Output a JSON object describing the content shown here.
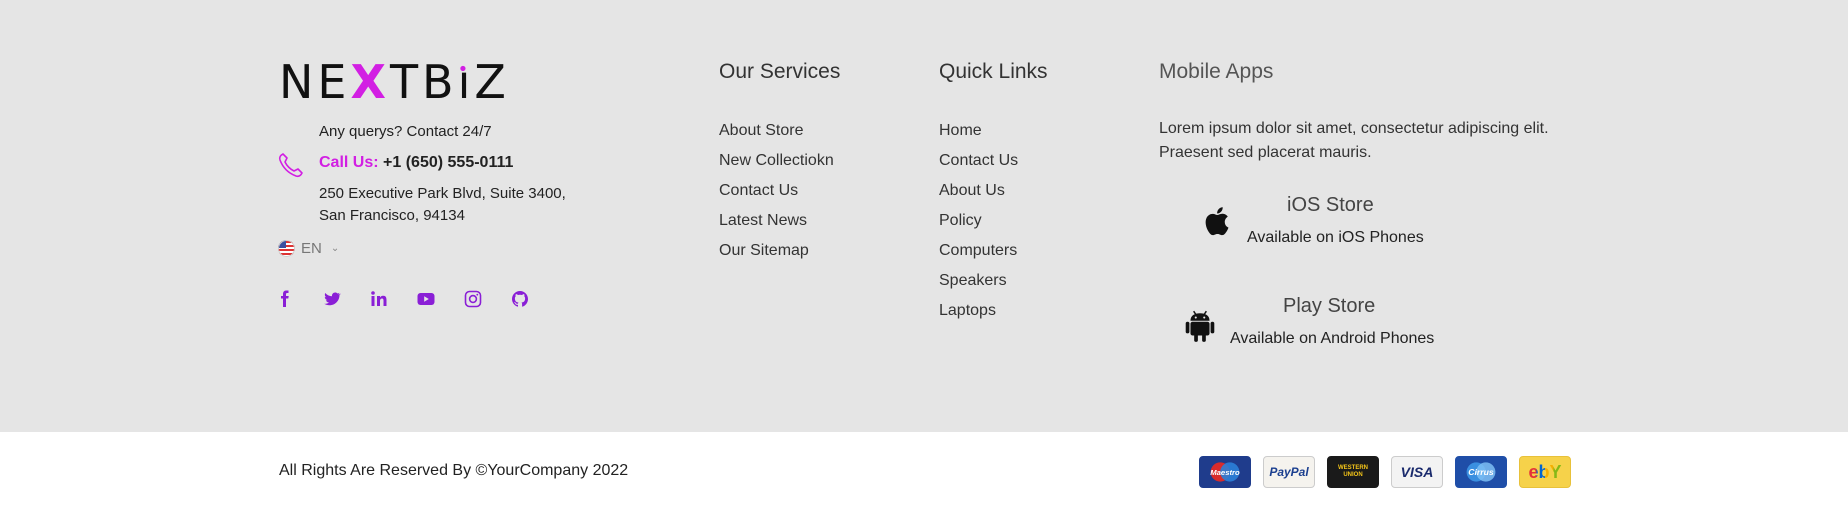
{
  "brand": {
    "logo": {
      "part1": "NE",
      "accent": "X",
      "part2": "TB",
      "i_stem": "ı",
      "i_dot": "•",
      "part3": "Z"
    }
  },
  "contact": {
    "tagline": "Any querys? Contact 24/7",
    "call_label": "Call Us:",
    "phone": "+1 (650) 555-0111",
    "address_line1": "250 Executive Park Blvd, Suite 3400,",
    "address_line2": "San Francisco, 94134"
  },
  "language": {
    "code": "EN"
  },
  "socials": [
    "facebook-icon",
    "twitter-icon",
    "linkedin-icon",
    "youtube-icon",
    "instagram-icon",
    "github-icon"
  ],
  "colors": {
    "accent": "#d21fe3",
    "social": "#8a1fd6",
    "bg_top": "#e5e5e5"
  },
  "services": {
    "title": "Our Services",
    "items": [
      "About Store",
      "New Collectiokn",
      "Contact Us",
      "Latest News",
      "Our Sitemap"
    ]
  },
  "quick_links": {
    "title": "Quick Links",
    "items": [
      "Home",
      "Contact Us",
      "About Us",
      "Policy",
      "Computers",
      "Speakers",
      "Laptops"
    ]
  },
  "apps": {
    "title": "Mobile Apps",
    "description": "Lorem ipsum dolor sit amet, consectetur adipiscing elit. Praesent sed placerat mauris.",
    "ios": {
      "name": "iOS Store",
      "sub": "Available on iOS Phones"
    },
    "play": {
      "name": "Play Store",
      "sub": "Available on Android Phones"
    }
  },
  "footer": {
    "copyright": "All Rights Are Reserved By ©YourCompany 2022",
    "cards": [
      "Maestro",
      "PayPal",
      "WESTERN UNION",
      "VISA",
      "Cirrus",
      "ebY"
    ]
  }
}
